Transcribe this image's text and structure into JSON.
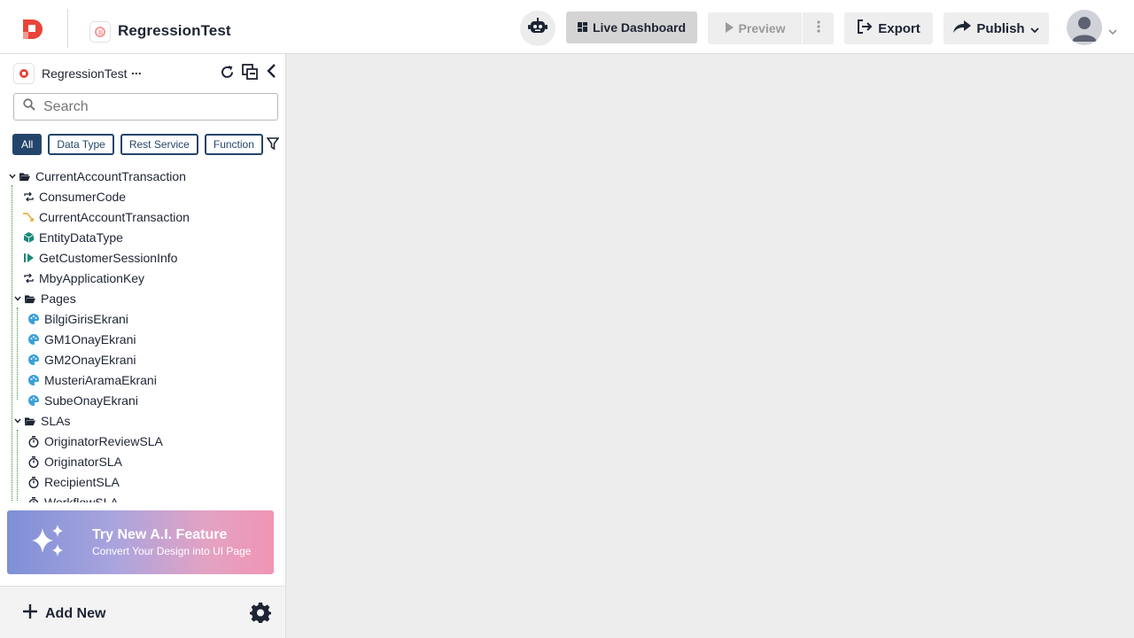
{
  "app": {
    "title": "RegressionTest"
  },
  "header": {
    "live_dashboard": "Live Dashboard",
    "preview": "Preview",
    "export": "Export",
    "publish": "Publish"
  },
  "sidebar": {
    "title": "RegressionTest",
    "menu_dots": "...",
    "search_placeholder": "Search",
    "filters": [
      "All",
      "Data Type",
      "Rest Service",
      "Function"
    ],
    "tree": {
      "root": "CurrentAccountTransaction",
      "items": [
        "ConsumerCode",
        "CurrentAccountTransaction",
        "EntityDataType",
        "GetCustomerSessionInfo",
        "MbyApplicationKey"
      ],
      "pages_folder": "Pages",
      "pages": [
        "BilgiGirisEkrani",
        "GM1OnayEkrani",
        "GM2OnayEkrani",
        "MusteriAramaEkrani",
        "SubeOnayEkrani"
      ],
      "slas_folder": "SLAs",
      "slas": [
        "OriginatorReviewSLA",
        "OriginatorSLA",
        "RecipientSLA",
        "WorkflowSLA"
      ]
    },
    "ai_card": {
      "title": "Try New A.I. Feature",
      "subtitle": "Convert Your Design into UI Page"
    },
    "add_new": "Add New"
  },
  "colors": {
    "accent": "#24456b",
    "brand": "#e8443a",
    "page_icon": "#3aa0d8",
    "entity_icon": "#1a8a7a",
    "ai_gradient_start": "#7e8fd6",
    "ai_gradient_end": "#f095b4"
  }
}
